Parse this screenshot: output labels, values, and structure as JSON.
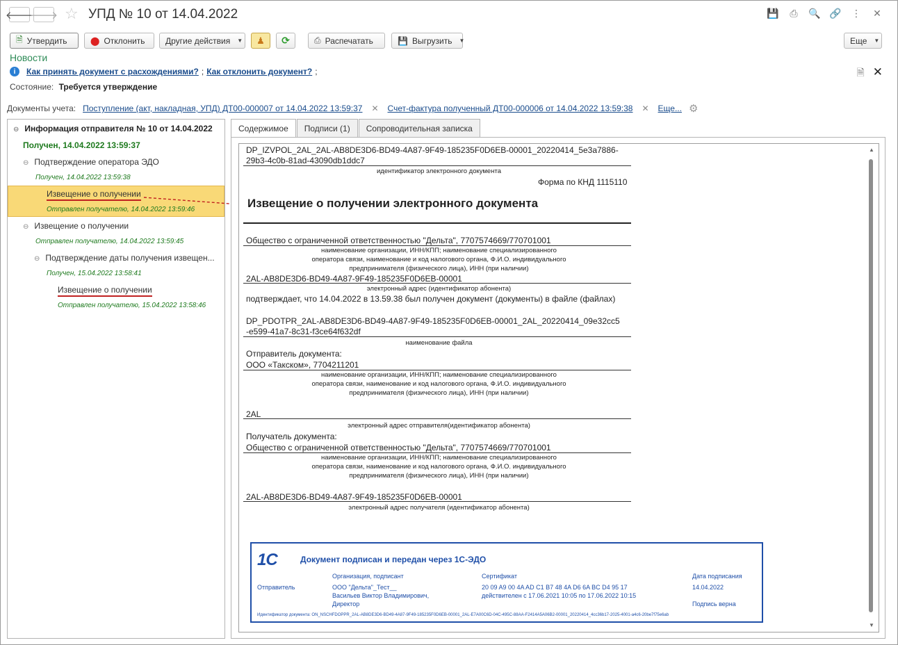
{
  "window": {
    "title": "УПД № 10 от 14.04.2022"
  },
  "toolbar": {
    "approve": "Утвердить",
    "reject": "Отклонить",
    "other_actions": "Другие действия",
    "print": "Распечатать",
    "export": "Выгрузить",
    "more": "Еще"
  },
  "news": {
    "label": "Новости",
    "link1": "Как принять документ с расхождениями?",
    "link_sep": ";",
    "link2": "Как отклонить документ?",
    "link2_tail": ";"
  },
  "state": {
    "label": "Состояние:",
    "value": "Требуется утверждение"
  },
  "accounting_docs": {
    "label": "Документы учета:",
    "doc1": "Поступление (акт, накладная, УПД) ДТ00-000007 от 14.04.2022 13:59:37",
    "doc2": "Счет-фактура полученный ДТ00-000006 от 14.04.2022 13:59:38",
    "more": "Еще..."
  },
  "tree": {
    "root": "Информация отправителя № 10 от 14.04.2022",
    "root_status": "Получен, 14.04.2022 13:59:37",
    "n1": "Подтверждение оператора ЭДО",
    "n1_status": "Получен, 14.04.2022 13:59:38",
    "n1a": "Извещение о получении",
    "n1a_status": "Отправлен получателю, 14.04.2022 13:59:46",
    "n2": "Извещение о получении",
    "n2_status": "Отправлен получателю, 14.04.2022 13:59:45",
    "n3": "Подтверждение даты получения извещен...",
    "n3_status": "Получен, 15.04.2022 13:58:41",
    "n3a": "Извещение о получении",
    "n3a_status": "Отправлен получателю, 15.04.2022 13:58:46"
  },
  "tabs": [
    "Содержимое",
    "Подписи (1)",
    "Сопроводительная записка"
  ],
  "document": {
    "file_id": "DP_IZVPOL_2AL_2AL-AB8DE3D6-BD49-4A87-9F49-185235F0D6EB-00001_20220414_5e3a7886-",
    "file_id2": "29b3-4c0b-81ad-43090db1ddc7",
    "cap_id": "идентификатор электронного документа",
    "form": "Форма по КНД 1115110",
    "heading": "Извещение о получении электронного документа",
    "org": "Общество с ограниченной ответственностью \"Дельта\", 7707574669/770701001",
    "cap_org1": "наименование организации, ИНН/КПП; наименование специализированного",
    "cap_org2": "оператора связи, наименование и код налогового органа, Ф.И.О. индивидуального",
    "cap_org3": "предпринимателя (физического лица), ИНН (при наличии)",
    "addr": "2AL-AB8DE3D6-BD49-4A87-9F49-185235F0D6EB-00001",
    "cap_addr": "электронный адрес (идентификатор абонента)",
    "confirms": "подтверждает, что 14.04.2022 в 13.59.38 был получен документ (документы) в файле (файлах)",
    "fname1": "DP_PDOTPR_2AL-AB8DE3D6-BD49-4A87-9F49-185235F0D6EB-00001_2AL_20220414_09e32cc5",
    "fname2": "-e599-41a7-8c31-f3ce64f632df",
    "cap_fname": "наименование файла",
    "sender_label": "Отправитель документа:",
    "sender": "ООО «Такском», 7704211201",
    "sender_addr": "2AL",
    "cap_sender_addr": "электронный адрес отправителя(идентификатор абонента)",
    "recipient_label": "Получатель документа:",
    "recipient": "Общество с ограниченной ответственностью \"Дельта\", 7707574669/770701001",
    "recipient_addr": "2AL-AB8DE3D6-BD49-4A87-9F49-185235F0D6EB-00001",
    "cap_recipient_addr": "электронный адрес получателя (идентификатор абонента)"
  },
  "stamp": {
    "logo": "1С",
    "title": "Документ подписан и передан через 1С-ЭДО",
    "col_org": "Организация, подписант",
    "col_cert": "Сертификат",
    "col_date": "Дата подписания",
    "role": "Отправитель",
    "org1": "ООО \"Дельта\"_Тест__",
    "org2": "Васильев Виктор Владимирович,",
    "org3": "Директор",
    "cert1": "20 09 A9 00 4A AD C1 B7 48 4A D6 6A BC D4 95 17",
    "cert2": "действителен с 17.06.2021 10:05 по 17.06.2022 10:15",
    "date": "14.04.2022",
    "valid": "Подпись верна",
    "doc_id": "Идентификатор документа: ON_NSCHFDOPPR_2AL-AB8DE3D6-BD49-4A87-9F49-185235F0D6EB-00001_2AL-E7A00C6D-04C-495C-88AA-F2414A5A06B2-00001_20220414_4cc36b17-2025-4001-a4c6-20be7f75e6ab"
  }
}
